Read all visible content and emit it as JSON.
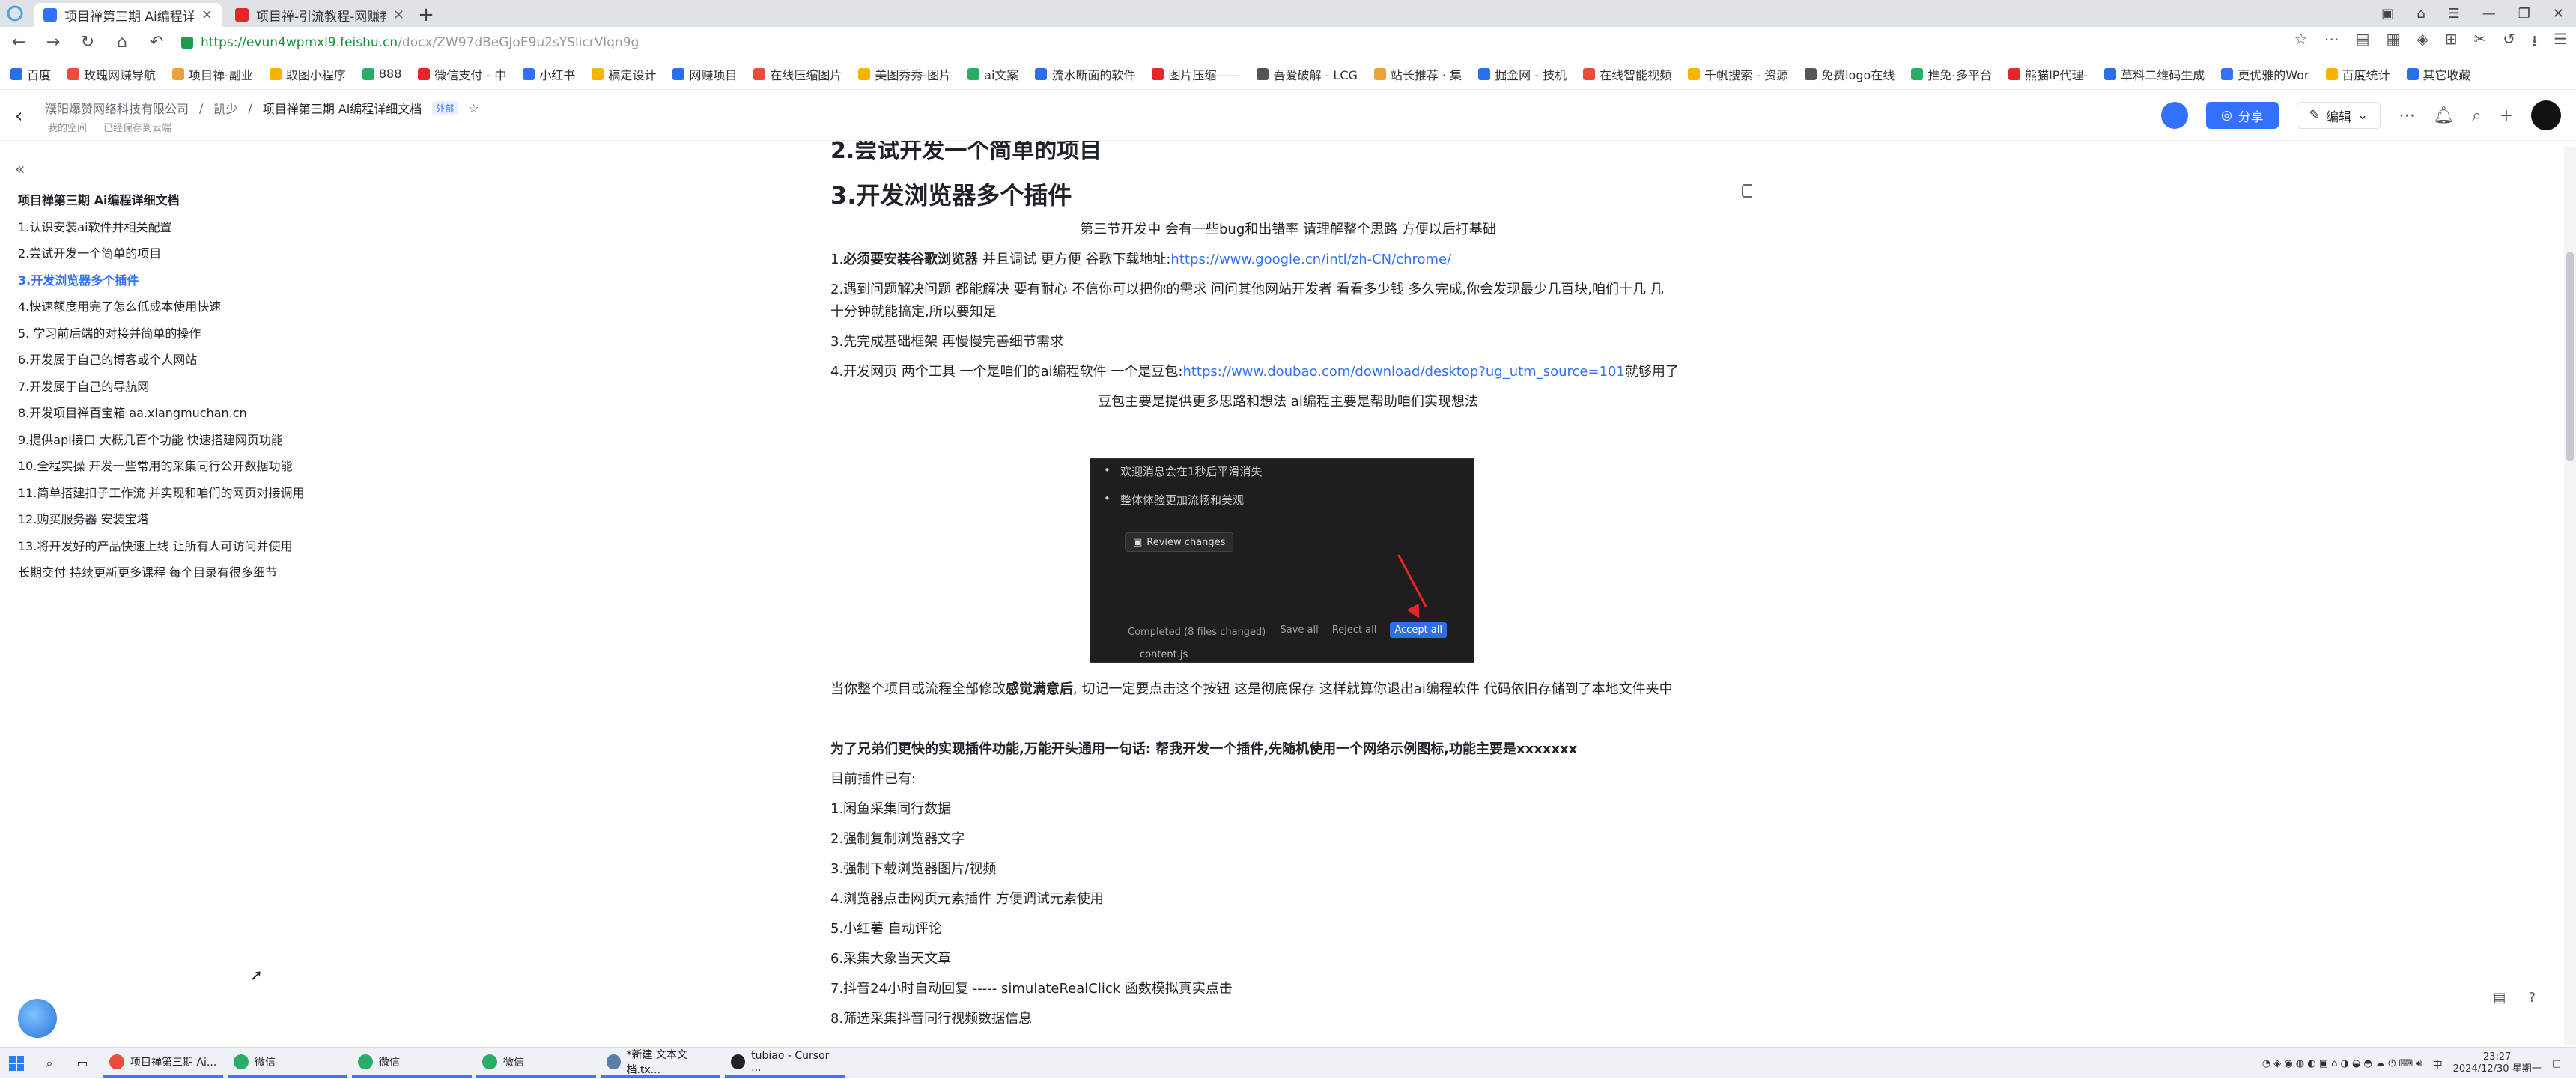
{
  "browser": {
    "tabs": [
      {
        "title": "项目禅第三期 Ai编程详细",
        "color": "#3370ff",
        "active": true
      },
      {
        "title": "项目禅-引流教程-网赚教",
        "color": "#e5262b",
        "active": false
      }
    ],
    "new_tab": "+",
    "url": "https://evun4wpmxl9.feishu.cn",
    "url_path": "/docx/ZW97dBeGJoE9u2sYSlicrVlqn9g",
    "bookmarks": [
      "百度",
      "玫瑰网赚导航",
      "项目禅-副业",
      "取图小程序",
      "888",
      "微信支付 - 中",
      "小红书",
      "稿定设计",
      "网赚项目",
      "在线压缩图片",
      "美图秀秀-图片",
      "ai文案",
      "流水断面的软件",
      "图片压缩——",
      "吾爱破解 - LCG",
      "站长推荐 · 集",
      "掘金网 - 技机",
      "在线智能视频",
      "千帆搜索 - 资源",
      "免费logo在线",
      "推免-多平台",
      "熊猫IP代理-",
      "草料二维码生成",
      "更优雅的Wor",
      "百度统计",
      "其它收藏"
    ]
  },
  "header": {
    "crumbs": [
      "濮阳爆赞网络科技有限公司",
      "凯少",
      "项目禅第三期  Ai编程详细文档"
    ],
    "ext_tag": "外部",
    "sub": [
      "我的空间",
      "已经保存到云端"
    ],
    "share": "分享",
    "edit": "编辑"
  },
  "toc": {
    "items": [
      {
        "label": "项目禅第三期 Ai编程详细文档",
        "kind": "title"
      },
      {
        "label": "1.认识安装ai软件并相关配置",
        "kind": "normal"
      },
      {
        "label": "2.尝试开发一个简单的项目",
        "kind": "normal"
      },
      {
        "label": "3.开发浏览器多个插件",
        "kind": "active"
      },
      {
        "label": "4.快速额度用完了怎么低成本使用快速",
        "kind": "normal"
      },
      {
        "label": "5. 学习前后端的对接并简单的操作",
        "kind": "normal"
      },
      {
        "label": "6.开发属于自己的博客或个人网站",
        "kind": "normal"
      },
      {
        "label": "7.开发属于自己的导航网",
        "kind": "normal"
      },
      {
        "label": "8.开发项目禅百宝箱 aa.xiangmuchan.cn",
        "kind": "normal"
      },
      {
        "label": "9.提供api接口 大概几百个功能 快速搭建网页功能",
        "kind": "normal"
      },
      {
        "label": "10.全程实操 开发一些常用的采集同行公开数据功能",
        "kind": "normal"
      },
      {
        "label": "11.简单搭建扣子工作流 并实现和咱们的网页对接调用",
        "kind": "normal"
      },
      {
        "label": "12.购买服务器 安装宝塔",
        "kind": "normal"
      },
      {
        "label": "13.将开发好的产品快速上线 让所有人可访问并使用",
        "kind": "normal"
      },
      {
        "label": "长期交付 持续更新更多课程 每个目录有很多细节",
        "kind": "normal"
      }
    ]
  },
  "doc": {
    "cut_heading": "2.尝试开发一个简单的项目",
    "heading": "3.开发浏览器多个插件",
    "intro": "第三节开发中 会有一些bug和出错率 请理解整个思路 方便以后打基础",
    "p1_prefix": "1.",
    "p1_bold": "必须要安装谷歌浏览器",
    "p1_text": " 并且调试 更方便 谷歌下载地址:",
    "p1_link": "https://www.google.cn/intl/zh-CN/chrome/",
    "p2_line1": "2.遇到问题解决问题 都能解决 要有耐心 不信你可以把你的需求 问问其他网站开发者 看看多少钱 多久完成,你会发现最少几百块,咱们十几 几",
    "p2_line2": "十分钟就能搞定,所以要知足",
    "p3": "3.先完成基础框架 再慢慢完善细节需求",
    "p4_text": "4.开发网页 两个工具 一个是咱们的ai编程软件 一个是豆包:",
    "p4_link": "https://www.doubao.com/download/desktop?ug_utm_source=101",
    "p4_tail": "就够用了",
    "p5": "豆包主要是提供更多思路和想法   ai编程主要是帮助咱们实现想法",
    "shot": {
      "li1": "欢迎消息会在1秒后平滑消失",
      "li2": "整体体验更加流畅和美观",
      "review": "Review changes",
      "completed": "Completed (8 files changed)",
      "save_all": "Save all",
      "reject_all": "Reject all",
      "accept_all": "Accept all",
      "file": "content.js"
    },
    "p6_pre": "当你整个项目或流程全部修改",
    "p6_bold": "感觉满意后",
    "p6_post": ", 切记一定要点击这个按钮 这是彻底保存 这样就算你退出ai编程软件 代码依旧存储到了本地文件夹中",
    "p7": "为了兄弟们更快的实现插件功能,万能开头通用一句话: 帮我开发一个插件,先随机使用一个网络示例图标,功能主要是xxxxxxx",
    "p8": "目前插件已有:",
    "list": [
      "1.闲鱼采集同行数据",
      "2.强制复制浏览器文字",
      "3.强制下载浏览器图片/视频",
      "4.浏览器点击网页元素插件 方便调试元素使用",
      "5.小红薯 自动评论",
      "6.采集大象当天文章",
      "7.抖音24小时自动回复 ----- simulateRealClick 函数模拟真实点击",
      "8.筛选采集抖音同行视频数据信息"
    ]
  },
  "taskbar": {
    "items": [
      {
        "label": "项目禅第三期 Ai...",
        "color": "#e94b3c"
      },
      {
        "label": "微信",
        "color": "#2aae67"
      },
      {
        "label": "微信",
        "color": "#2aae67"
      },
      {
        "label": "微信",
        "color": "#2aae67"
      },
      {
        "label": "*新建 文本文档.tx...",
        "color": "#5a7ea8"
      },
      {
        "label": "tubiao - Cursor ...",
        "color": "#222222"
      }
    ],
    "ime": "中",
    "time": "23:27",
    "date": "2024/12/30 星期一"
  }
}
